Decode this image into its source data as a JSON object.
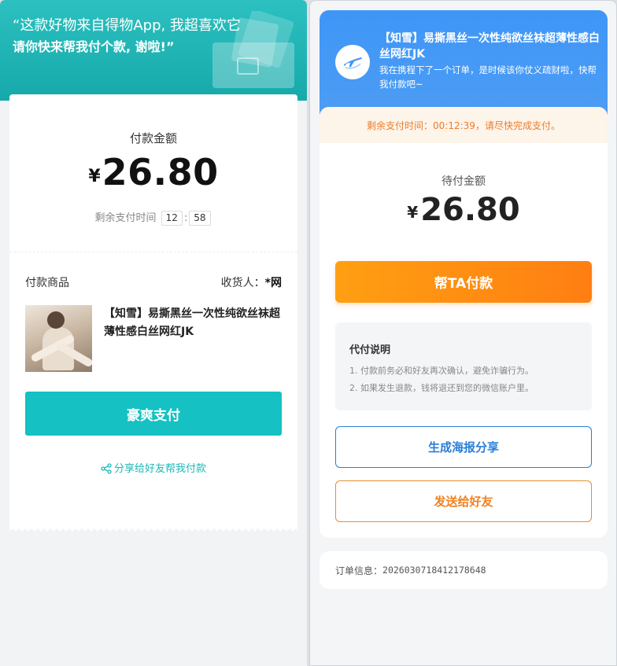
{
  "left": {
    "banner": {
      "line1": "“这款好物来自得物App, 我超喜欢它",
      "line2": "请你快来帮我付个款, 谢啦!”"
    },
    "amount_title": "付款金额",
    "currency": "¥",
    "amount": "26.80",
    "countdown_label": "剩余支付时间",
    "countdown_minutes": "12",
    "countdown_sep": ":",
    "countdown_seconds": "58",
    "goods_title": "付款商品",
    "receiver_label": "收货人：",
    "receiver_name": "*网",
    "goods_name": "【知雪】易撕黑丝一次性纯欲丝袜超薄性感白丝网红JK",
    "pay_button": "豪爽支付",
    "share_link": "分享给好友帮我付款",
    "accent_color": "#15c1c3"
  },
  "right": {
    "header_title": "【知雪】易撕黑丝一次性纯欲丝袜超薄性感白丝网红JK",
    "header_sub": "我在携程下了一个订单，是时候该你仗义疏财啦，快帮我付款吧~",
    "notice": "剩余支付时间：00:12:39，请尽快完成支付。",
    "amount_title": "待付金额",
    "currency": "¥",
    "amount": "26.80",
    "help_button": "帮TA付款",
    "explain_title": "代付说明",
    "explain_items": [
      "1. 付款前务必和好友再次确认，避免诈骗行为。",
      "2. 如果发生退款，钱将退还到您的微信账户里。"
    ],
    "poster_button": "生成海报分享",
    "send_button": "发送给好友",
    "order_label": "订单信息：",
    "order_no": "2026030718412178648",
    "brand_color": "#3f96f7",
    "cta_color": "#ff8c12"
  }
}
